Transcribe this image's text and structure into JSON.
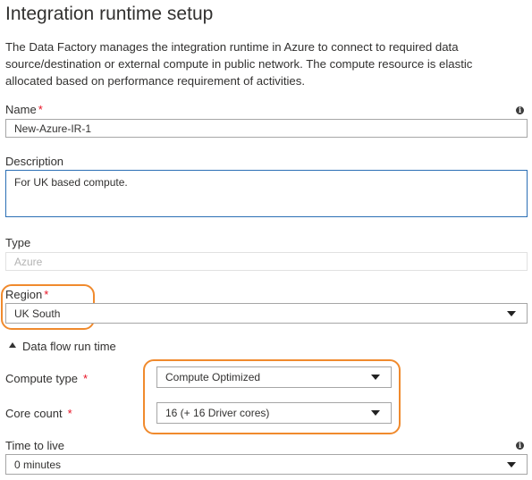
{
  "title": "Integration runtime setup",
  "description": "The Data Factory manages the integration runtime in Azure to connect to required data source/destination or external compute in public network. The compute resource is elastic allocated based on performance requirement of activities.",
  "required_mark": "*",
  "info_glyph": "i",
  "name": {
    "label": "Name",
    "value": "New-Azure-IR-1"
  },
  "description_field": {
    "label": "Description",
    "value": "For UK based compute."
  },
  "type": {
    "label": "Type",
    "value": "Azure"
  },
  "region": {
    "label": "Region",
    "value": "UK South"
  },
  "data_flow": {
    "section_label": "Data flow run time",
    "compute_type": {
      "label": "Compute type",
      "value": "Compute Optimized"
    },
    "core_count": {
      "label": "Core count",
      "value": "16 (+ 16 Driver cores)"
    },
    "time_to_live": {
      "label": "Time to live",
      "value": "0 minutes"
    }
  },
  "colors": {
    "highlight": "#f08a2d",
    "required": "#e81123",
    "focus_border": "#2b6fb5"
  },
  "icons": {
    "info": "info-icon",
    "dropdown": "chevron-down-icon",
    "section_toggle": "collapse-triangle-icon"
  }
}
